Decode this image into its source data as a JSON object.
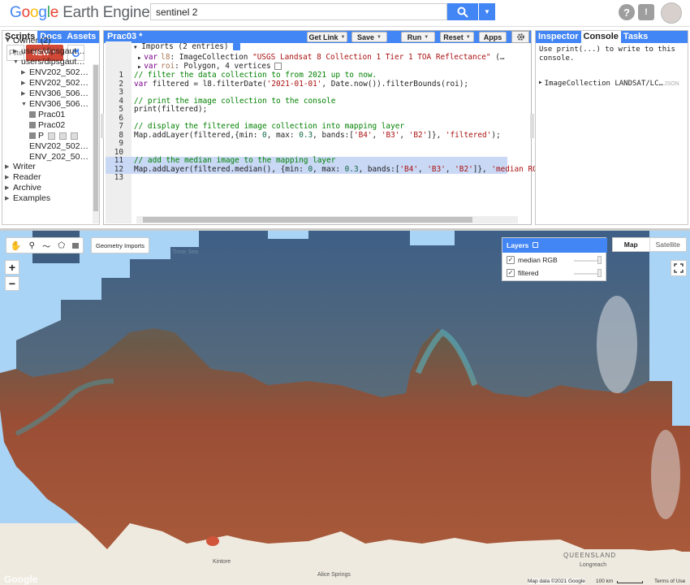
{
  "app": {
    "logo_parts": [
      "G",
      "o",
      "o",
      "g",
      "l",
      "e",
      " Earth Engine"
    ],
    "search_value": "sentinel 2"
  },
  "left_panel": {
    "tabs": [
      "Scripts",
      "Docs",
      "Assets"
    ],
    "filter_placeholder": "Filter",
    "new_label": "NEW",
    "tree": [
      {
        "label": "Owner (2)",
        "state": "open"
      },
      {
        "label": "users/dipsgaut…",
        "state": "closed"
      },
      {
        "label": "users/dipsgaut…",
        "state": "open"
      },
      {
        "label": "ENV202_502…",
        "state": "closed"
      },
      {
        "label": "ENV202_502…",
        "state": "closed"
      },
      {
        "label": "ENV306_506…",
        "state": "closed"
      },
      {
        "label": "ENV306_506…",
        "state": "open"
      },
      {
        "label": "Prac01",
        "state": "file"
      },
      {
        "label": "Prac02",
        "state": "file"
      },
      {
        "label": "P",
        "state": "file"
      },
      {
        "label": "ENV202_502…",
        "state": "none"
      },
      {
        "label": "ENV_202_50…",
        "state": "none"
      },
      {
        "label": "Writer",
        "state": "closed"
      },
      {
        "label": "Reader",
        "state": "closed"
      },
      {
        "label": "Archive",
        "state": "closed"
      },
      {
        "label": "Examples",
        "state": "closed"
      }
    ]
  },
  "editor": {
    "title": "Prac03 *",
    "buttons": [
      "Get Link",
      "Save",
      "Run",
      "Reset",
      "Apps"
    ],
    "imports_header": "Imports (2 entries)",
    "imports": [
      {
        "kw": "var",
        "name": "l8",
        "rest": ": ImageCollection ",
        "str": "\"USGS Landsat 8 Collection 1 Tier 1 TOA Reflectance\"",
        "tail": " (…"
      },
      {
        "kw": "var",
        "name": "roi",
        "rest": ": Polygon, 4 vertices",
        "str": "",
        "tail": ""
      }
    ],
    "line_numbers": [
      "1",
      "2",
      "3",
      "4",
      "5",
      "6",
      "7",
      "8",
      "9",
      "10",
      "11",
      "12",
      "13"
    ],
    "lines": [
      [
        {
          "t": "// filter the data collection to from 2021 up to now.",
          "c": "cm"
        }
      ],
      [
        {
          "t": "var",
          "c": "kw"
        },
        {
          "t": " filtered = l8.filterDate(",
          "c": ""
        },
        {
          "t": "'2021-01-01'",
          "c": "str"
        },
        {
          "t": ", Date.now()).filterBounds(roi);",
          "c": ""
        }
      ],
      [],
      [
        {
          "t": "// print the image collection to the console",
          "c": "cm"
        }
      ],
      [
        {
          "t": "print(filtered);",
          "c": ""
        }
      ],
      [],
      [
        {
          "t": "// display the filtered image collection into mapping layer",
          "c": "cm"
        }
      ],
      [
        {
          "t": "Map.addLayer(filtered,{min: ",
          "c": ""
        },
        {
          "t": "0",
          "c": "num"
        },
        {
          "t": ", max: ",
          "c": ""
        },
        {
          "t": "0.3",
          "c": "num"
        },
        {
          "t": ", bands:[",
          "c": ""
        },
        {
          "t": "'B4'",
          "c": "str"
        },
        {
          "t": ", ",
          "c": ""
        },
        {
          "t": "'B3'",
          "c": "str"
        },
        {
          "t": ", ",
          "c": ""
        },
        {
          "t": "'B2'",
          "c": "str"
        },
        {
          "t": "]}, ",
          "c": ""
        },
        {
          "t": "'filtered'",
          "c": "str"
        },
        {
          "t": ");",
          "c": ""
        }
      ],
      [],
      [],
      [
        {
          "t": "// add the median image to the mapping layer",
          "c": "cm"
        }
      ],
      [
        {
          "t": "Map.addLayer(filtered.median(), {min: ",
          "c": ""
        },
        {
          "t": "0",
          "c": "num"
        },
        {
          "t": ", max: ",
          "c": ""
        },
        {
          "t": "0.3",
          "c": "num"
        },
        {
          "t": ", bands:[",
          "c": ""
        },
        {
          "t": "'B4'",
          "c": "str"
        },
        {
          "t": ", ",
          "c": ""
        },
        {
          "t": "'B3'",
          "c": "str"
        },
        {
          "t": ", ",
          "c": ""
        },
        {
          "t": "'B2'",
          "c": "str"
        },
        {
          "t": "]}, ",
          "c": ""
        },
        {
          "t": "'median RGB'",
          "c": "str"
        }
      ],
      []
    ]
  },
  "right_panel": {
    "tabs": [
      "Inspector",
      "Console",
      "Tasks"
    ],
    "console_hint": "Use print(...) to write to this console.",
    "output_label": "ImageCollection LANDSAT/LC…",
    "output_tag": "JSON"
  },
  "map": {
    "geometry_imports": "Geometry Imports",
    "layers_title": "Layers",
    "layers": [
      {
        "name": "median RGB",
        "checked": true
      },
      {
        "name": "filtered",
        "checked": true
      }
    ],
    "map_type_buttons": [
      "Map",
      "Satellite"
    ],
    "active_map_type": "Map",
    "zoom_in": "+",
    "zoom_out": "−",
    "places": [
      "Timor Sea",
      "QUEENSLAND",
      "Longreach",
      "Kintore",
      "Alice Springs"
    ],
    "watermark": "Google",
    "attribution": "Map data ©2021 Google",
    "scale_label": "100 km",
    "terms": "Terms of Use"
  },
  "colors": {
    "accent": "#4285f4",
    "new_button": "#d14836",
    "ocean": "#a9d4f5",
    "land": "#efeae0",
    "highlight": "#c9d8f5"
  }
}
